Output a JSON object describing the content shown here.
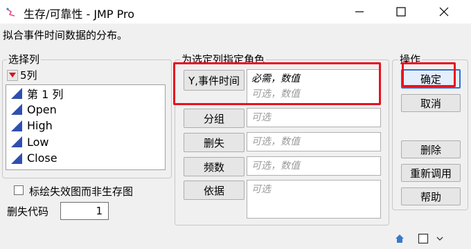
{
  "window": {
    "title": "生存/可靠性 - JMP Pro",
    "minimize_icon": "minimize-icon",
    "maximize_icon": "maximize-icon",
    "close_icon": "close-icon"
  },
  "description": "拟合事件时间数据的分布。",
  "select_columns": {
    "legend": "选择列",
    "count_label": "5列",
    "items": [
      {
        "label": "第 1 列"
      },
      {
        "label": "Open"
      },
      {
        "label": "High"
      },
      {
        "label": "Low"
      },
      {
        "label": "Close"
      }
    ]
  },
  "roles": {
    "legend": "为选定列指定角色",
    "y_event_time": {
      "button": "Y,事件时间",
      "required": "必需，数值",
      "optional": "可选，数值"
    },
    "group": {
      "button": "分组",
      "placeholder": "可选"
    },
    "censor": {
      "button": "删失",
      "placeholder": "可选，数值"
    },
    "frequency": {
      "button": "频数",
      "placeholder": "可选，数值"
    },
    "by": {
      "button": "依据",
      "placeholder": "可选"
    }
  },
  "actions": {
    "legend": "操作",
    "ok": "确定",
    "cancel": "取消",
    "remove": "删除",
    "recall": "重新调用",
    "help": "帮助"
  },
  "options": {
    "failure_plot_label": "标绘失效图而非生存图",
    "failure_plot_checked": false,
    "censor_code_label": "删失代码",
    "censor_code_value": "1"
  },
  "statusbar": {
    "home_icon": "home-icon",
    "window_icon": "window-icon",
    "dropdown_icon": "chevron-down-icon"
  },
  "colors": {
    "highlight": "#e8101f",
    "column_icon": "#2f4fb0",
    "primary_border": "#2f6fd6"
  }
}
